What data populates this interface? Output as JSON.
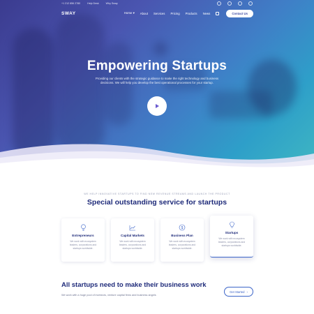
{
  "topbar": {
    "phone": "+1 212 856 2780",
    "help": "Help Desk",
    "why": "Why Sway",
    "social_icons": [
      "facebook-icon",
      "twitter-icon",
      "instagram-icon",
      "pinterest-icon"
    ]
  },
  "nav": {
    "logo": "SWAY",
    "items": [
      "Home",
      "About",
      "Services",
      "Pricing",
      "Products",
      "News"
    ],
    "home_caret": "▾",
    "contact_label": "Contact Us"
  },
  "hero": {
    "title": "Empowering Startups",
    "subtitle": "Providing our clients with the strategic guidance to make the right technology and business decisions. We will help you develop the best operational processes for your startup."
  },
  "services": {
    "eyebrow": "WE HELP INNOVATIVE STARTUPS TO FIND NEW REVENUE STREAMS AND LAUNCH THE PRODUCT",
    "title": "Special outstanding service for startups",
    "cards": [
      {
        "title": "Entrepreneurs",
        "desc": "We work with ecosystem leaders, corporations and startups worldwide.",
        "icon": "lightbulb-icon"
      },
      {
        "title": "Capital Markets",
        "desc": "We work with ecosystem leaders, corporations and startups worldwide.",
        "icon": "chart-icon"
      },
      {
        "title": "Business Plan",
        "desc": "We work with ecosystem leaders, corporations and startups worldwide.",
        "icon": "dollar-icon"
      },
      {
        "title": "Startups",
        "desc": "We work with ecosystem leaders, corporations and startups worldwide.",
        "icon": "bulb-icon"
      }
    ]
  },
  "bottom": {
    "title": "All startups need to make their business work",
    "subtitle": "We work with a huge pool of investors, venture capital firms and business angels",
    "button_label": "Get Started",
    "button_arrow": "›"
  },
  "colors": {
    "brand_navy": "#1f2b7a",
    "accent_blue": "#3b64c8",
    "hero_gradient_start": "#3b3b8f",
    "hero_gradient_end": "#3fb7c2"
  }
}
